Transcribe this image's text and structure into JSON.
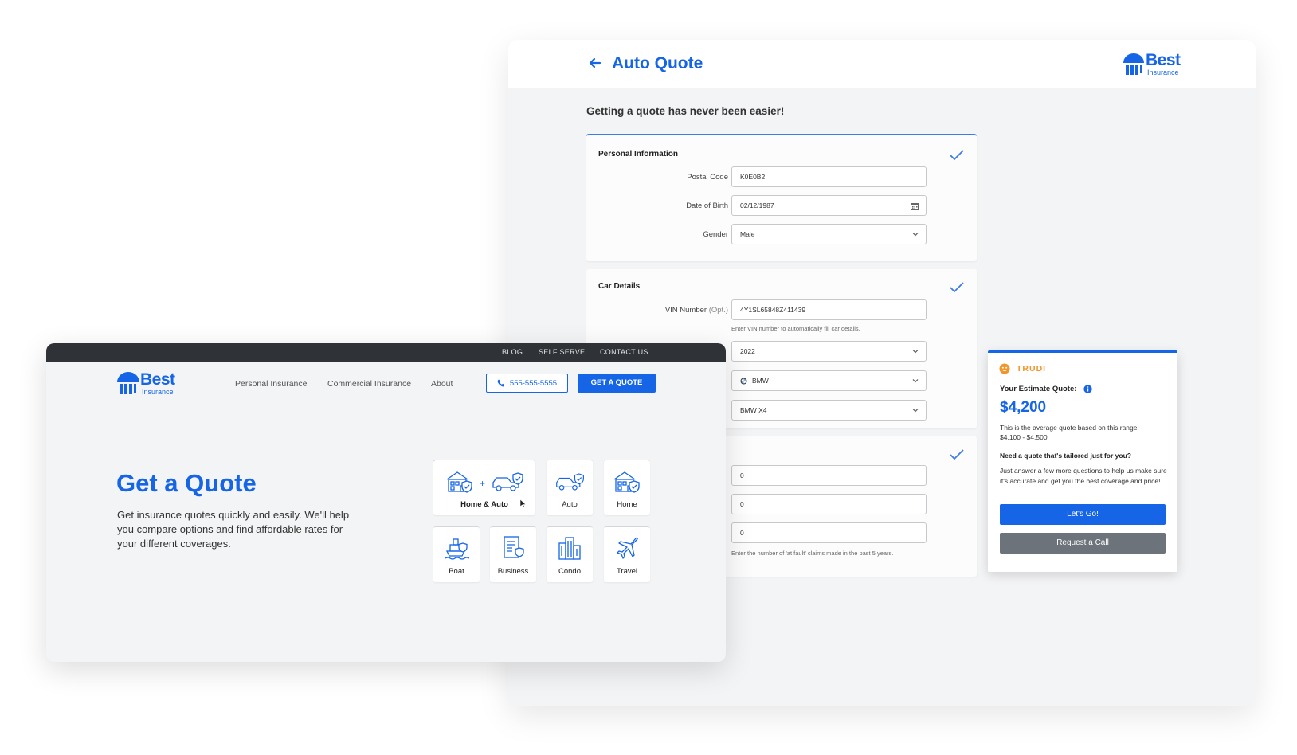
{
  "auto_quote": {
    "title": "Auto Quote",
    "subtitle": "Getting a quote has never been easier!",
    "logo": {
      "name": "Best",
      "sub": "Insurance"
    },
    "personal": {
      "title": "Personal Information",
      "postal_label": "Postal Code",
      "postal_value": "K0E0B2",
      "dob_label": "Date of Birth",
      "dob_value": "02/12/1987",
      "gender_label": "Gender",
      "gender_value": "Male"
    },
    "car": {
      "title": "Car Details",
      "vin_label": "VIN Number",
      "vin_opt": "(Opt.)",
      "vin_value": "4Y1SL65848Z411439",
      "vin_hint": "Enter VIN number to automatically fill car details.",
      "year_value": "2022",
      "make_value": "BMW",
      "model_value": "BMW X4"
    },
    "claims": {
      "values": [
        "0",
        "0",
        "0"
      ],
      "hint": "Enter the number of 'at fault' claims made in the past 5 years."
    }
  },
  "trudi": {
    "brand": "TRUDI",
    "estimate_label": "Your Estimate Quote:",
    "price": "$4,200",
    "range_text": "This is the average quote based on this range:",
    "range": "$4,100 - $4,500",
    "tailored": "Need a quote that's tailored just for you?",
    "body": "Just answer a few more questions to help us make sure it's accurate and get you the best coverage and price!",
    "go_button": "Let's Go!",
    "call_button": "Request a Call"
  },
  "site": {
    "topbar": [
      "BLOG",
      "SELF SERVE",
      "CONTACT US"
    ],
    "logo": {
      "name": "Best",
      "sub": "Insurance"
    },
    "nav": [
      "Personal Insurance",
      "Commercial Insurance",
      "About"
    ],
    "phone": "555-555-5555",
    "cta": "GET A QUOTE",
    "hero_title": "Get a Quote",
    "hero_text": "Get insurance quotes quickly and easily. We'll help you compare options and find affordable rates for your different coverages.",
    "tiles": [
      "Home & Auto",
      "Auto",
      "Home",
      "Boat",
      "Business",
      "Condo",
      "Travel"
    ]
  },
  "colors": {
    "brand_blue": "#1565e6",
    "trudi_orange": "#f0962a",
    "topbar": "#2f3236"
  }
}
